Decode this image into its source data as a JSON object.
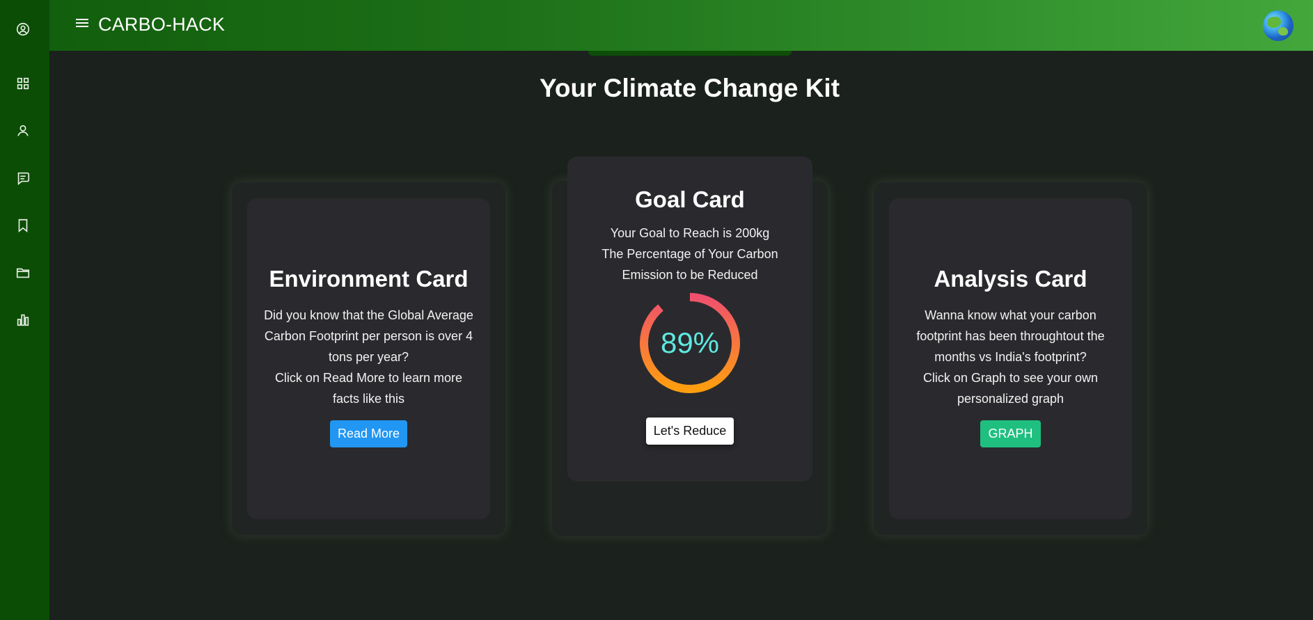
{
  "app": {
    "brand": "CARBO-HACK"
  },
  "sidebar": {
    "items": [
      {
        "icon": "user-circle-icon"
      },
      {
        "icon": "dashboard-grid-icon"
      },
      {
        "icon": "person-icon"
      },
      {
        "icon": "chat-icon"
      },
      {
        "icon": "bookmark-icon"
      },
      {
        "icon": "folder-icon"
      },
      {
        "icon": "bar-chart-icon"
      }
    ]
  },
  "page": {
    "title": "Your Climate Change Kit"
  },
  "environment_card": {
    "title": "Environment Card",
    "body_line1": "Did you know that the Global Average Carbon Footprint per person is over 4 tons per year?",
    "body_line2": "Click on Read More to learn more facts like this",
    "button": "Read More"
  },
  "goal_card": {
    "title": "Goal Card",
    "goal_text": "Your Goal to Reach is 200kg",
    "desc": "The Percentage of Your Carbon Emission to be Reduced",
    "percent_label": "89%",
    "percent_value": 0.89,
    "button": "Let's Reduce"
  },
  "analysis_card": {
    "title": "Analysis Card",
    "body_line1": "Wanna know what your carbon footprint has been throughtout the months vs India's footprint?",
    "body_line2": "Click on Graph to see your own personalized graph",
    "button": "GRAPH"
  },
  "colors": {
    "sidebar": "#0c4d06",
    "header_start": "#125f0d",
    "header_end": "#43a73c",
    "read_more_button": "#2196f3",
    "graph_button": "#1fbf7f",
    "progress_start": "#ff9e0f",
    "progress_end": "#f0506e",
    "progress_text": "#5ee9e0"
  }
}
